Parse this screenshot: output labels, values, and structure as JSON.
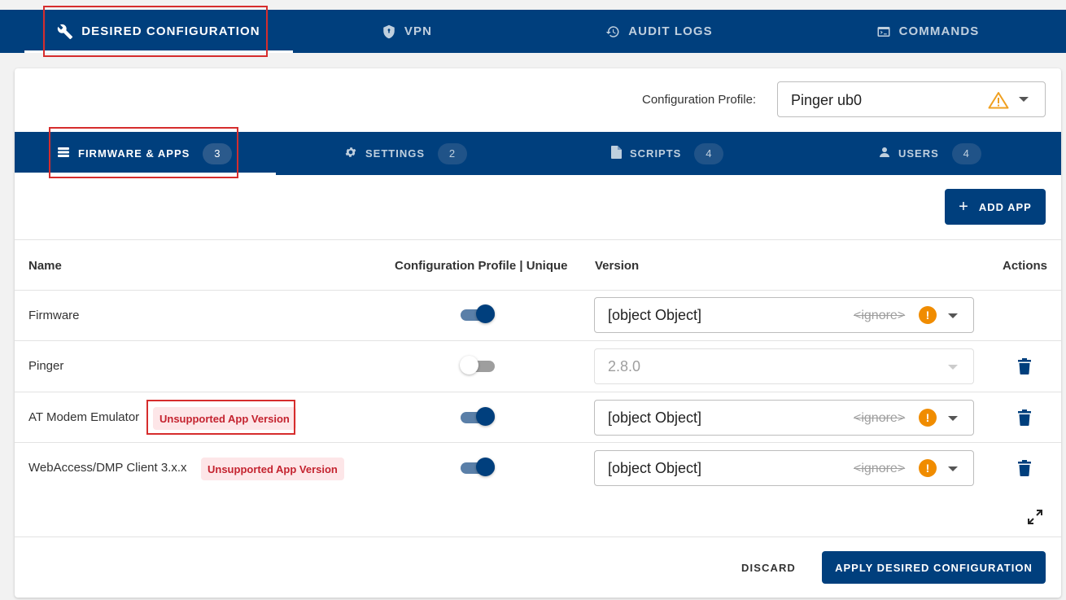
{
  "top_tabs": [
    {
      "label": "DESIRED CONFIGURATION",
      "icon": "wrench-icon"
    },
    {
      "label": "VPN",
      "icon": "shield-icon"
    },
    {
      "label": "AUDIT LOGS",
      "icon": "history-icon"
    },
    {
      "label": "COMMANDS",
      "icon": "terminal-icon"
    }
  ],
  "profile": {
    "label": "Configuration Profile:",
    "value": "Pinger ub0",
    "warning_icon": "warning-icon"
  },
  "sub_tabs": [
    {
      "label": "FIRMWARE & APPS",
      "count": "3",
      "icon": "chip-icon"
    },
    {
      "label": "SETTINGS",
      "count": "2",
      "icon": "gear-icon"
    },
    {
      "label": "SCRIPTS",
      "count": "4",
      "icon": "file-icon"
    },
    {
      "label": "USERS",
      "count": "4",
      "icon": "person-icon"
    }
  ],
  "add_app_label": "ADD APP",
  "table": {
    "headers": [
      "Name",
      "Configuration Profile | Unique",
      "Version",
      "Actions"
    ],
    "rows": [
      {
        "name": "Firmware",
        "toggle_on": true,
        "version": "[object Object]",
        "ignore": "<ignore>",
        "badge": ""
      },
      {
        "name": "Pinger",
        "toggle_on": false,
        "version": "2.8.0",
        "ignore": "",
        "badge": ""
      },
      {
        "name": "AT Modem Emulator",
        "toggle_on": true,
        "version": "[object Object]",
        "ignore": "<ignore>",
        "badge": "Unsupported App Version"
      },
      {
        "name": "WebAccess/DMP Client 3.x.x",
        "toggle_on": true,
        "version": "[object Object]",
        "ignore": "<ignore>",
        "badge": "Unsupported App Version"
      }
    ]
  },
  "footer": {
    "discard_label": "DISCARD",
    "apply_label": "APPLY DESIRED CONFIGURATION"
  },
  "colors": {
    "primary": "#003f7d",
    "warning": "#f08c00",
    "badge_text": "#c4232f",
    "badge_bg": "#fde6e8",
    "highlight": "#d62d2d"
  }
}
